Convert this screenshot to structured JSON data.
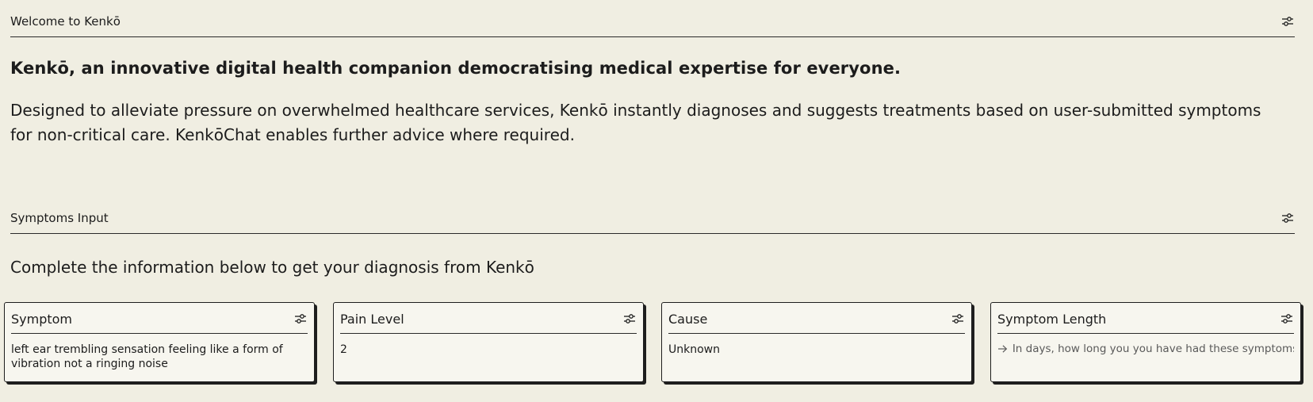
{
  "welcome_section": {
    "title": "Welcome to Kenkō",
    "settings_icon": "sliders-icon"
  },
  "intro": {
    "headline": "Kenkō, an innovative digital health companion democratising medical expertise for everyone.",
    "description": "Designed to alleviate pressure on overwhelmed healthcare services, Kenkō instantly diagnoses and suggests treatments based on user-submitted symptoms for non-critical care. KenkōChat enables further advice where required."
  },
  "symptoms_section": {
    "title": "Symptoms Input",
    "settings_icon": "sliders-icon",
    "instruction": "Complete the information below to get your diagnosis from Kenkō"
  },
  "cards": [
    {
      "label": "Symptom",
      "value": "left ear trembling sensation feeling like a form of vibration not a ringing noise"
    },
    {
      "label": "Pain Level",
      "value": "2"
    },
    {
      "label": "Cause",
      "value": "Unknown"
    },
    {
      "label": "Symptom Length",
      "value": "",
      "placeholder": "In days, how long you you have had these symptoms?",
      "input_icon": "arrow-right-icon"
    }
  ],
  "colors": {
    "background": "#f0eee2",
    "card_background": "#f7f6ef",
    "text": "#1c1c1c",
    "border": "#1e1e1e"
  }
}
